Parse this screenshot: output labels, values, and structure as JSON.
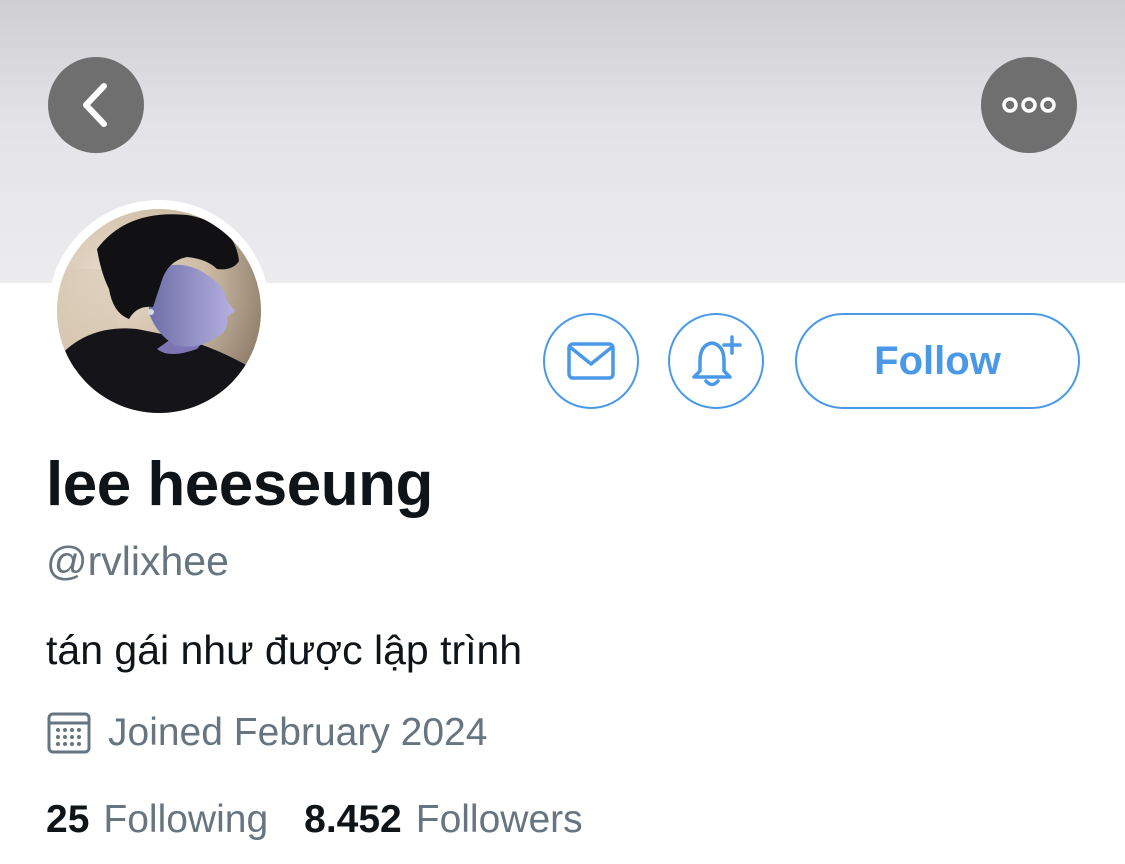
{
  "header": {
    "back_icon": "chevron-left-icon",
    "more_icon": "ellipsis-icon"
  },
  "profile": {
    "display_name": "lee heeseung",
    "handle": "@rvlixhee",
    "bio": "tán gái như được lập trình",
    "joined": "Joined February 2024"
  },
  "actions": {
    "message_icon": "envelope-icon",
    "notify_icon": "bell-plus-icon",
    "follow_label": "Follow"
  },
  "stats": {
    "following_count": "25",
    "following_label": "Following",
    "followers_count": "8.452",
    "followers_label": "Followers"
  },
  "colors": {
    "accent": "#4a99e9",
    "secondary_text": "#66757f",
    "primary_text": "#0f1419",
    "overlay_button": "#6f6f6f"
  }
}
